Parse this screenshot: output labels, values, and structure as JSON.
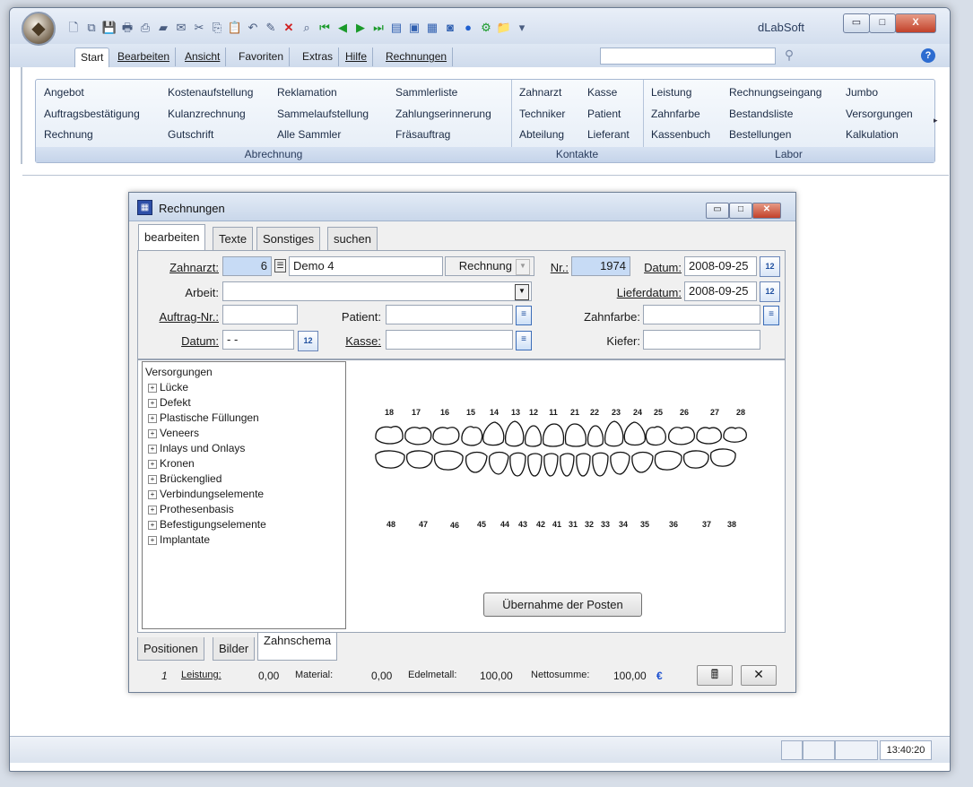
{
  "app": {
    "title": "dLabSoft",
    "window_buttons": {
      "minimize": "▭",
      "maximize": "□",
      "close": "X"
    }
  },
  "menu": {
    "tabs": [
      "Start",
      "Bearbeiten",
      "Ansicht",
      "Favoriten",
      "Extras",
      "Hilfe",
      "Rechnungen"
    ],
    "search_placeholder": ""
  },
  "ribbon": {
    "abrechnung": {
      "title": "Abrechnung",
      "items": [
        "Angebot",
        "Kostenaufstellung",
        "Reklamation",
        "Sammlerliste",
        "Auftragsbestätigung",
        "Kulanzrechnung",
        "Sammelaufstellung",
        "Zahlungserinnerung",
        "Rechnung",
        "Gutschrift",
        "Alle Sammler",
        "Fräsauftrag"
      ]
    },
    "kontakte": {
      "title": "Kontakte",
      "items": [
        "Zahnarzt",
        "Kasse",
        "Techniker",
        "Patient",
        "Abteilung",
        "Lieferant"
      ]
    },
    "labor": {
      "title": "Labor",
      "items": [
        "Leistung",
        "Rechnungseingang",
        "Jumbo",
        "Zahnfarbe",
        "Bestandsliste",
        "Versorgungen",
        "Kassenbuch",
        "Bestellungen",
        "Kalkulation"
      ]
    }
  },
  "child": {
    "title": "Rechnungen",
    "tabs": [
      "bearbeiten",
      "Texte",
      "Sonstiges",
      "suchen"
    ],
    "form": {
      "zahnarzt_label": "Zahnarzt:",
      "zahnarzt_nr": "6",
      "zahnarzt_name": "Demo 4",
      "doc_type": "Rechnung",
      "nr_label": "Nr.:",
      "nr_value": "1974",
      "datum_label": "Datum:",
      "datum_value": "2008-09-25",
      "arbeit_label": "Arbeit:",
      "arbeit_value": "",
      "lieferdatum_label": "Lieferdatum:",
      "lieferdatum_value": "2008-09-25",
      "auftrag_label": "Auftrag-Nr.:",
      "auftrag_value": "",
      "patient_label": "Patient:",
      "patient_value": "",
      "zahnfarbe_label": "Zahnfarbe:",
      "zahnfarbe_value": "",
      "datum2_label": "Datum:",
      "datum2_value": "- -",
      "kasse_label": "Kasse:",
      "kasse_value": "",
      "kiefer_label": "Kiefer:",
      "kiefer_value": ""
    },
    "tree": {
      "root": "Versorgungen",
      "items": [
        "Lücke",
        "Defekt",
        "Plastische Füllungen",
        "Veneers",
        "Inlays und Onlays",
        "Kronen",
        "Brückenglied",
        "Verbindungselemente",
        "Prothesenbasis",
        "Befestigungselemente",
        "Implantate"
      ]
    },
    "teeth_upper": [
      "18",
      "17",
      "16",
      "15",
      "14",
      "13",
      "12",
      "11",
      "21",
      "22",
      "23",
      "24",
      "25",
      "26",
      "27",
      "28"
    ],
    "teeth_lower": [
      "48",
      "47",
      "46",
      "45",
      "44",
      "43",
      "42",
      "41",
      "31",
      "32",
      "33",
      "34",
      "35",
      "36",
      "37",
      "38"
    ],
    "uebernahme_label": "Übernahme der Posten",
    "bottom_tabs": [
      "Positionen",
      "Bilder",
      "Zahnschema"
    ],
    "footer": {
      "count": "1",
      "leistung_label": "Leistung:",
      "leistung_value": "0,00",
      "material_label": "Material:",
      "material_value": "0,00",
      "edelmetall_label": "Edelmetall:",
      "edelmetall_value": "100,00",
      "netto_label": "Nettosumme:",
      "netto_value": "100,00",
      "currency": "€"
    }
  },
  "status": {
    "clock": "13:40:20"
  }
}
